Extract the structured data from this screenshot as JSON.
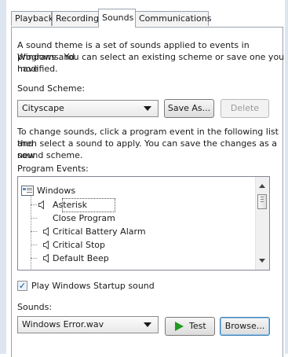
{
  "tabs": [
    {
      "label": "Playback"
    },
    {
      "label": "Recording"
    },
    {
      "label": "Sounds"
    },
    {
      "label": "Communications"
    }
  ],
  "description_text": {
    "line1": "A sound theme is a set of sounds applied to events in Windows and",
    "line2": "programs.  You can select an existing scheme or save one you have",
    "line3": "modified."
  },
  "sound_scheme": {
    "label": "Sound Scheme:",
    "selected": "Cityscape",
    "save_as_label": "Save As...",
    "delete_label": "Delete"
  },
  "instructions_text": {
    "line1": "To change sounds, click a program event in the following list and",
    "line2": "then select a sound to apply.  You can save the changes as a new",
    "line3": "sound scheme."
  },
  "program_events": {
    "label": "Program Events:",
    "group": "Windows",
    "items": [
      {
        "label": "Asterisk",
        "has_sound": true
      },
      {
        "label": "Close Program",
        "has_sound": false
      },
      {
        "label": "Critical Battery Alarm",
        "has_sound": true
      },
      {
        "label": "Critical Stop",
        "has_sound": true
      },
      {
        "label": "Default Beep",
        "has_sound": true
      }
    ]
  },
  "startup_sound": {
    "label": "Play Windows Startup sound",
    "checked": true
  },
  "sounds": {
    "label": "Sounds:",
    "selected": "Windows Error.wav",
    "test_label": "Test",
    "browse_label": "Browse..."
  },
  "colors": {
    "accent_green": "#1f9a1f",
    "frame": "#dde6f0"
  }
}
